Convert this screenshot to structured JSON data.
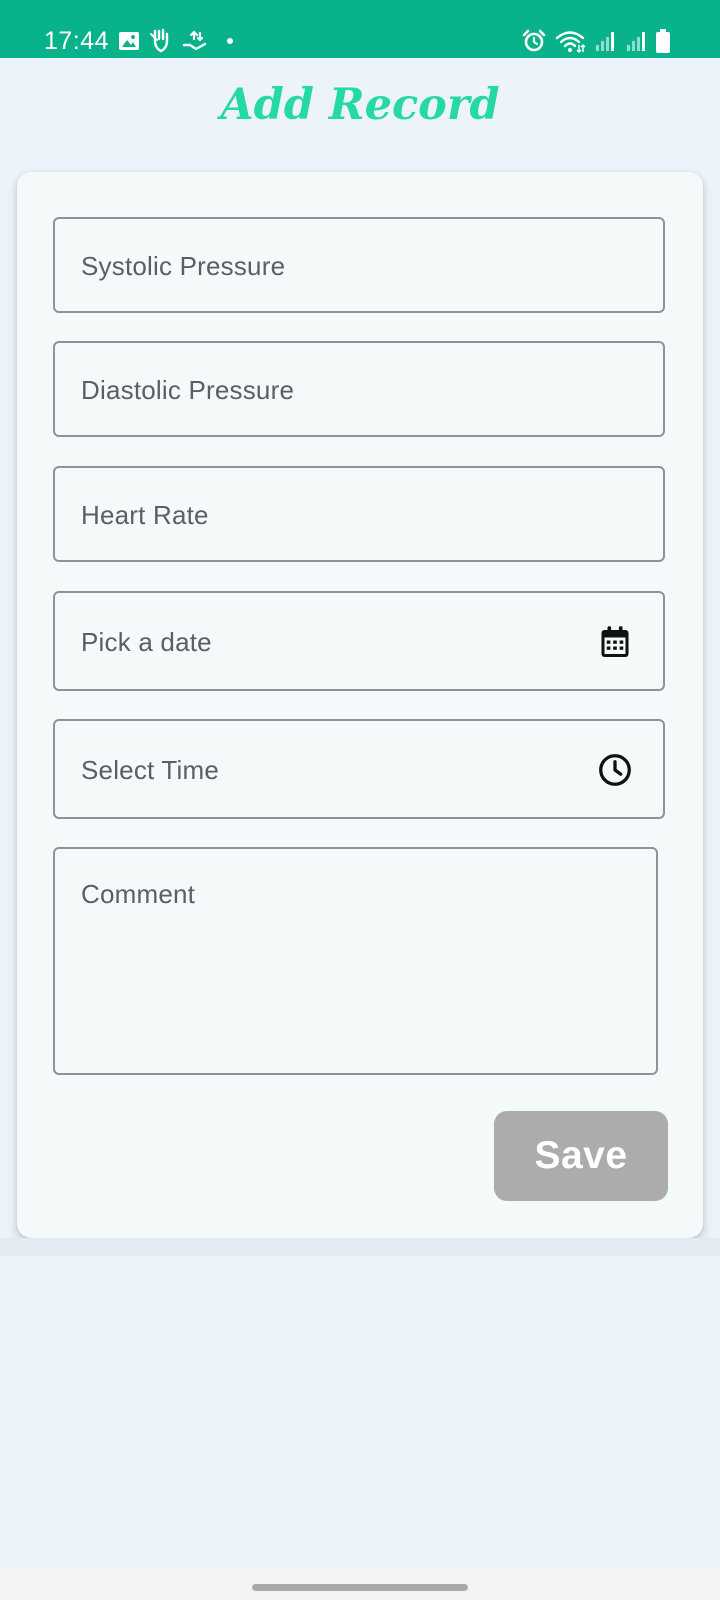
{
  "status_bar": {
    "time": "17:44",
    "left_icons": [
      "gallery-icon",
      "hand-shield-icon",
      "hand-share-icon"
    ],
    "right_icons": [
      "alarm-icon",
      "wifi-icon",
      "signal-icon",
      "signal-icon",
      "battery-icon"
    ]
  },
  "page": {
    "title": "Add Record"
  },
  "form": {
    "systolic_placeholder": "Systolic Pressure",
    "diastolic_placeholder": "Diastolic Pressure",
    "heart_rate_placeholder": "Heart Rate",
    "date_placeholder": "Pick a date",
    "time_placeholder": "Select Time",
    "comment_placeholder": "Comment",
    "date_icon": "calendar-icon",
    "time_icon": "clock-icon",
    "save_label": "Save"
  },
  "colors": {
    "status_bar": "#08b28a",
    "title": "#25d9a3",
    "save_button": "#acacac"
  }
}
